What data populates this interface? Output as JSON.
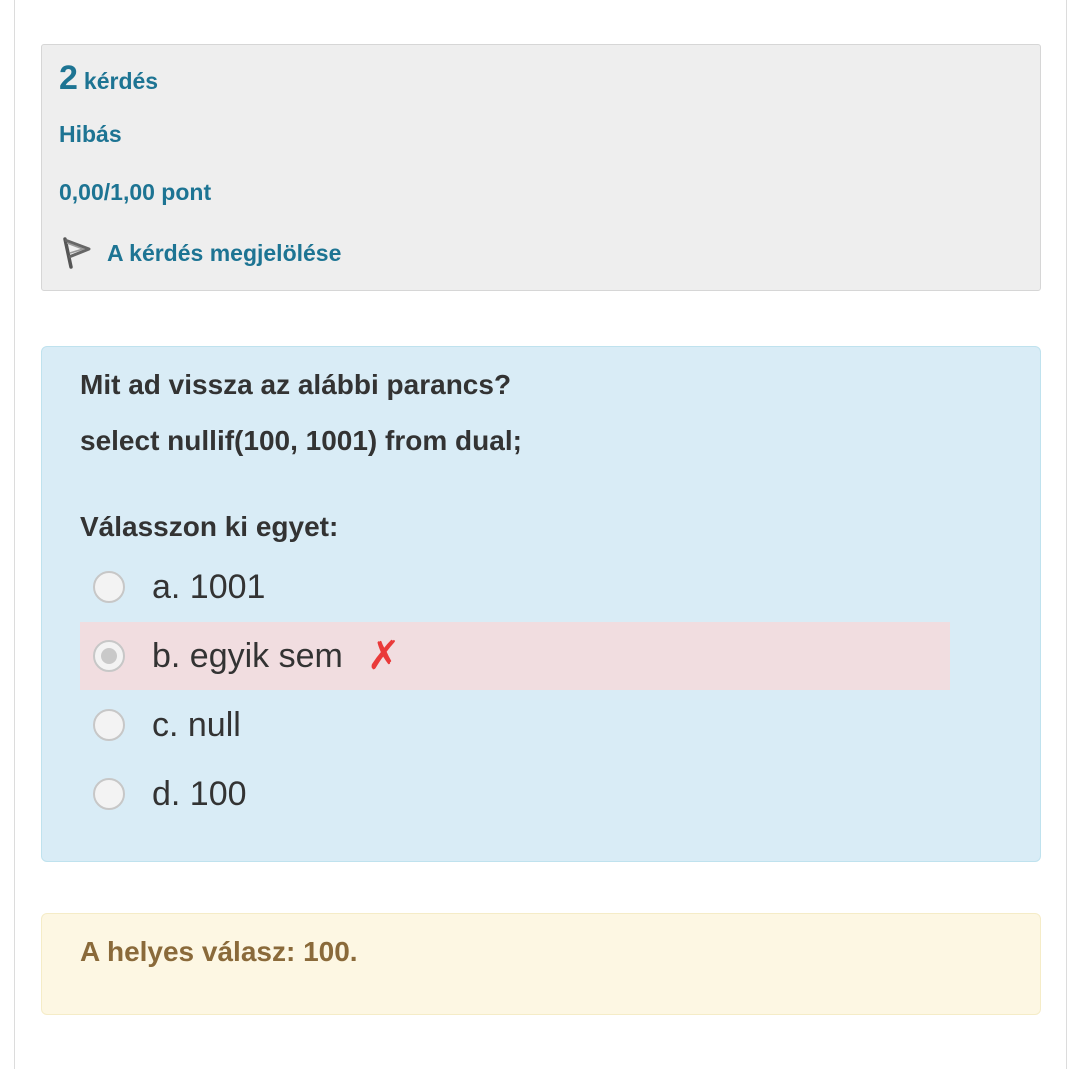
{
  "info": {
    "number": "2",
    "word": "kérdés",
    "state": "Hibás",
    "grade": "0,00/1,00 pont",
    "flag_label": "A kérdés megjelölése"
  },
  "question": {
    "text": "Mit ad vissza az alábbi parancs?",
    "code": "select nullif(100, 1001) from dual;",
    "prompt": "Válasszon ki egyet:",
    "answers": [
      {
        "label": "a. 1001",
        "selected": false
      },
      {
        "label": "b. egyik sem",
        "selected": true,
        "mark": "✗"
      },
      {
        "label": "c. null",
        "selected": false
      },
      {
        "label": "d. 100",
        "selected": false
      }
    ]
  },
  "feedback": {
    "right_answer": "A helyes válasz: 100."
  },
  "colors": {
    "info_text": "#1d7493",
    "content_bg": "#d9ecf6",
    "incorrect_bg": "#f1dde0",
    "wrong_mark": "#ea3a3a",
    "feedback_bg": "#fdf7e3",
    "feedback_text": "#8a6a3a"
  },
  "icons": {
    "flag": "flag-icon",
    "wrong": "cross-icon"
  }
}
